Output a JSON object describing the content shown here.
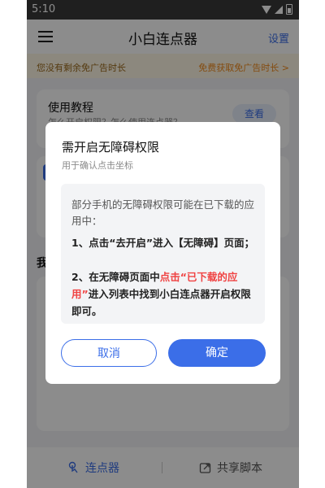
{
  "status_bar": {
    "time": "5:10"
  },
  "app_bar": {
    "title": "小白连点器",
    "settings": "设置"
  },
  "ad_bar": {
    "left": "您没有剩余免广告时长",
    "right": "免费获取免广告时长 >"
  },
  "tutorial": {
    "title": "使用教程",
    "subtitle": "怎么开启权限？怎么使用连点器？",
    "view": "查看"
  },
  "section": {
    "title": "我"
  },
  "bottom_nav": {
    "clicker": "连点器",
    "share": "共享脚本"
  },
  "dialog": {
    "title": "需开启无障碍权限",
    "subtitle": "用于确认点击坐标",
    "intro": "部分手机的无障碍权限可能在已下载的应用中：",
    "step1": "1、点击“去开启”进入【无障碍】页面；",
    "step2_prefix": "2、在无障碍页面中",
    "step2_highlight": "点击“已下载的应用”",
    "step2_suffix": "进入列表中找到小白连点器开启权限即可。",
    "cancel": "取消",
    "confirm": "确定"
  },
  "colors": {
    "accent": "#3b6ee8",
    "highlight": "#f04343",
    "ad_text": "#f08a1c"
  }
}
